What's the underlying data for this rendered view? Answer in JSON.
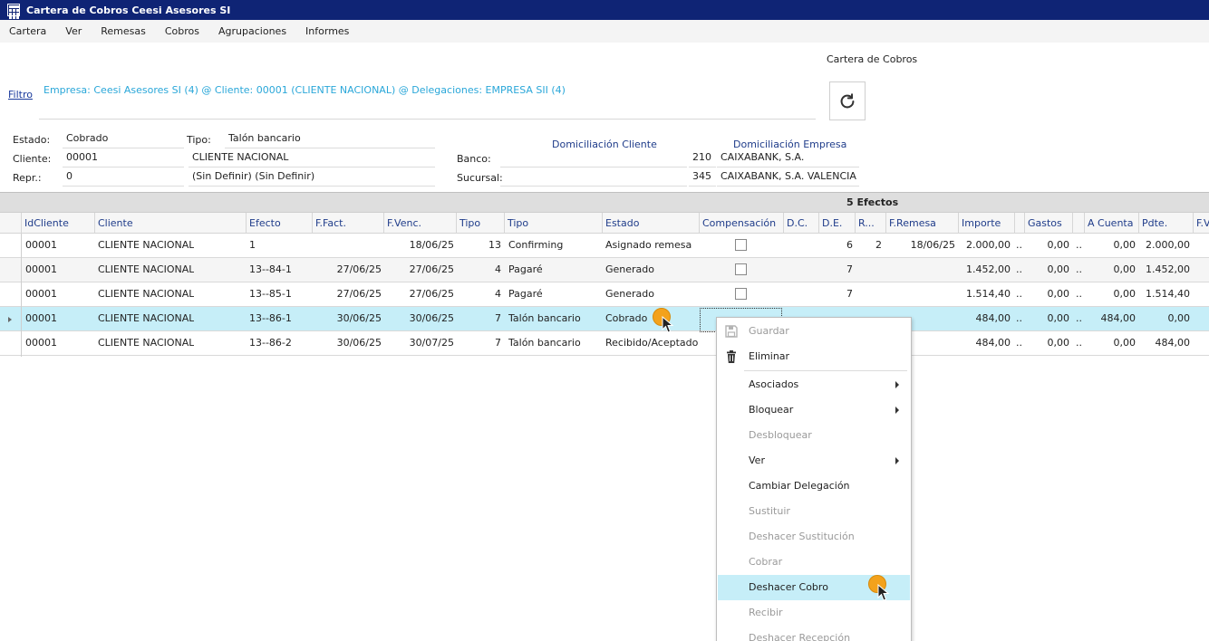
{
  "window": {
    "title": "Cartera de Cobros Ceesi Asesores SI"
  },
  "menubar": {
    "items": [
      "Cartera",
      "Ver",
      "Remesas",
      "Cobros",
      "Agrupaciones",
      "Informes"
    ]
  },
  "filter": {
    "link_label": "Filtro",
    "text": "Empresa: Ceesi Asesores SI (4) @ Cliente: 00001 (CLIENTE NACIONAL) @ Delegaciones: EMPRESA SII (4)"
  },
  "panel": {
    "title": "Cartera de Cobros",
    "refresh_icon": "refresh-icon"
  },
  "details": {
    "estado_label": "Estado:",
    "estado_value": "Cobrado",
    "tipo_label": "Tipo:",
    "tipo_value": "Talón bancario",
    "cliente_label": "Cliente:",
    "cliente_code": "00001",
    "cliente_name": "CLIENTE NACIONAL",
    "repr_label": "Repr.:",
    "repr_code": "0",
    "repr_name": "(Sin Definir) (Sin Definir)",
    "dom_cliente_label": "Domiciliación Cliente",
    "dom_empresa_label": "Domiciliación Empresa",
    "banco_label": "Banco:",
    "banco_cliente": "",
    "banco_empresa_code": "210",
    "banco_empresa_name": "CAIXABANK, S.A.",
    "sucursal_label": "Sucursal:",
    "sucursal_cliente": "",
    "sucursal_empresa_code": "345",
    "sucursal_empresa_name": "CAIXABANK, S.A. VALENCIA"
  },
  "grid": {
    "count_label": "5 Efectos",
    "columns": [
      "IdCliente",
      "Cliente",
      "Efecto",
      "F.Fact.",
      "F.Venc.",
      "Tipo",
      "Tipo",
      "Estado",
      "Compensación",
      "D.C.",
      "D.E.",
      "R...",
      "F.Remesa",
      "Importe",
      "",
      "Gastos",
      "",
      "A Cuenta",
      "Pdte.",
      "F.V"
    ],
    "rows": [
      {
        "idcliente": "00001",
        "cliente": "CLIENTE NACIONAL",
        "efecto": "1",
        "ffact": "",
        "fvenc": "18/06/25",
        "tipo_num": "13",
        "tipo": "Confirming",
        "estado": "Asignado remesa",
        "de": "6",
        "r": "2",
        "fremesa": "18/06/25",
        "importe": "2.000,00",
        "dots1": "..",
        "gastos": "0,00",
        "dots2": "..",
        "acuenta": "0,00",
        "pdte": "2.000,00"
      },
      {
        "idcliente": "00001",
        "cliente": "CLIENTE NACIONAL",
        "efecto": "13--84-1",
        "ffact": "27/06/25",
        "fvenc": "27/06/25",
        "tipo_num": "4",
        "tipo": "Pagaré",
        "estado": "Generado",
        "de": "7",
        "r": "",
        "fremesa": "",
        "importe": "1.452,00",
        "dots1": "..",
        "gastos": "0,00",
        "dots2": "..",
        "acuenta": "0,00",
        "pdte": "1.452,00"
      },
      {
        "idcliente": "00001",
        "cliente": "CLIENTE NACIONAL",
        "efecto": "13--85-1",
        "ffact": "27/06/25",
        "fvenc": "27/06/25",
        "tipo_num": "4",
        "tipo": "Pagaré",
        "estado": "Generado",
        "de": "7",
        "r": "",
        "fremesa": "",
        "importe": "1.514,40",
        "dots1": "..",
        "gastos": "0,00",
        "dots2": "..",
        "acuenta": "0,00",
        "pdte": "1.514,40"
      },
      {
        "idcliente": "00001",
        "cliente": "CLIENTE NACIONAL",
        "efecto": "13--86-1",
        "ffact": "30/06/25",
        "fvenc": "30/06/25",
        "tipo_num": "7",
        "tipo": "Talón bancario",
        "estado": "Cobrado",
        "de": "",
        "r": "",
        "fremesa": "",
        "importe": "484,00",
        "dots1": "..",
        "gastos": "0,00",
        "dots2": "..",
        "acuenta": "484,00",
        "pdte": "0,00"
      },
      {
        "idcliente": "00001",
        "cliente": "CLIENTE NACIONAL",
        "efecto": "13--86-2",
        "ffact": "30/06/25",
        "fvenc": "30/07/25",
        "tipo_num": "7",
        "tipo": "Talón bancario",
        "estado": "Recibido/Aceptado",
        "de": "",
        "r": "",
        "fremesa": "",
        "importe": "484,00",
        "dots1": "..",
        "gastos": "0,00",
        "dots2": "..",
        "acuenta": "0,00",
        "pdte": "484,00"
      }
    ]
  },
  "context_menu": {
    "items": [
      {
        "label": "Guardar",
        "icon": "save-icon"
      },
      {
        "label": "Eliminar",
        "icon": "trash-icon"
      },
      {
        "label": "Asociados"
      },
      {
        "label": "Bloquear"
      },
      {
        "label": "Desbloquear"
      },
      {
        "label": "Ver"
      },
      {
        "label": "Cambiar Delegación"
      },
      {
        "label": "Sustituir"
      },
      {
        "label": "Deshacer Sustitución"
      },
      {
        "label": "Cobrar"
      },
      {
        "label": "Deshacer Cobro"
      },
      {
        "label": "Recibir"
      },
      {
        "label": "Deshacer Recepción"
      }
    ]
  },
  "colors": {
    "titlebar": "#0f2475",
    "selection": "#c6eef8",
    "header_text": "#1f3c8a",
    "filter_text": "#2aa7d9",
    "cursor": "#f3a21c"
  }
}
